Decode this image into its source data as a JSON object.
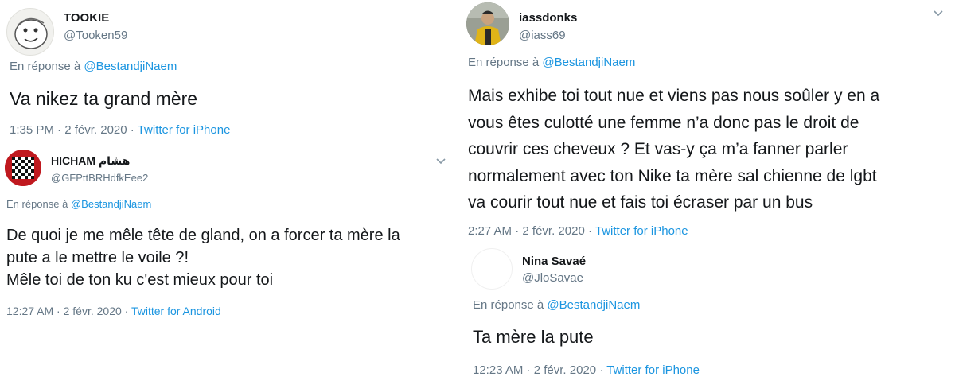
{
  "tweets": [
    {
      "name": "TOOKIE",
      "handle": "@Tooken59",
      "reply_prefix": "En réponse à",
      "reply_to": "@BestandjiNaem",
      "lines": [
        "Va nikez ta grand mère"
      ],
      "time": "1:35 PM",
      "date": "2 févr. 2020",
      "source": "Twitter for iPhone"
    },
    {
      "name": "HICHAM هشام",
      "handle": "@GFPttBRHdfkEee2",
      "reply_prefix": "En réponse à",
      "reply_to": "@BestandjiNaem",
      "lines": [
        "De quoi je me mêle tête de gland, on a forcer ta mère la",
        "pute a le mettre le voile ?!",
        "Mêle toi de ton ku c'est mieux pour toi"
      ],
      "time": "12:27 AM",
      "date": "2 févr. 2020",
      "source": "Twitter for Android"
    },
    {
      "name": "iassdonks",
      "handle": "@iass69_",
      "reply_prefix": "En réponse à",
      "reply_to": "@BestandjiNaem",
      "lines": [
        "Mais exhibe toi tout nue et viens pas nous soûler y en a",
        "vous êtes culotté une femme n’a donc pas le droit de",
        "couvrir ces cheveux  ? Et vas-y ça m’a fanner parler",
        "normalement avec ton Nike ta mère sal chienne de lgbt",
        "va courir tout nue et fais toi écraser par un bus"
      ],
      "time": "2:27 AM",
      "date": "2 févr. 2020",
      "source": "Twitter for iPhone"
    },
    {
      "name": "Nina Savaé",
      "handle": "@JloSavae",
      "reply_prefix": "En réponse à",
      "reply_to": "@BestandjiNaem",
      "lines": [
        "Ta mère la pute"
      ],
      "time": "12:23 AM",
      "date": "2 févr. 2020",
      "source": "Twitter for iPhone"
    }
  ],
  "meta_separator": "·",
  "colors": {
    "text": "#14171a",
    "muted": "#657786",
    "link": "#1b95e0"
  }
}
